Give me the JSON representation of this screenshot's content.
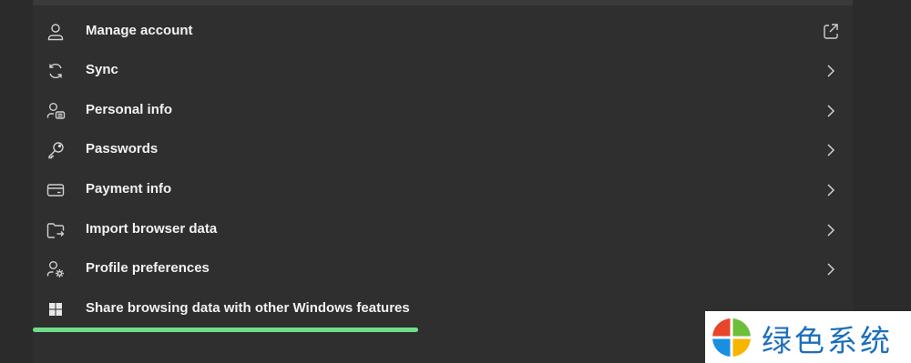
{
  "settings_list": {
    "items": [
      {
        "label": "Manage account",
        "icon": "person-icon",
        "trailing_icon": "external-link-icon"
      },
      {
        "label": "Sync",
        "icon": "sync-icon",
        "trailing_icon": "chevron-right-icon"
      },
      {
        "label": "Personal info",
        "icon": "personal-info-icon",
        "trailing_icon": "chevron-right-icon"
      },
      {
        "label": "Passwords",
        "icon": "key-icon",
        "trailing_icon": "chevron-right-icon"
      },
      {
        "label": "Payment info",
        "icon": "credit-card-icon",
        "trailing_icon": "chevron-right-icon"
      },
      {
        "label": "Import browser data",
        "icon": "import-folder-icon",
        "trailing_icon": "chevron-right-icon"
      },
      {
        "label": "Profile preferences",
        "icon": "profile-settings-icon",
        "trailing_icon": "chevron-right-icon"
      },
      {
        "label": "Share browsing data with other Windows features",
        "icon": "windows-logo-icon",
        "trailing_icon": "chevron-right-icon"
      }
    ]
  },
  "highlight": {
    "color": "#6ee08b"
  },
  "watermark": {
    "text": "绿色系统",
    "text_color": "#1c6fbd",
    "logo": "windows-color-logo"
  },
  "colors": {
    "background": "#2b2b2b",
    "text": "#f2f2f2",
    "icon": "#d0d0d0"
  }
}
